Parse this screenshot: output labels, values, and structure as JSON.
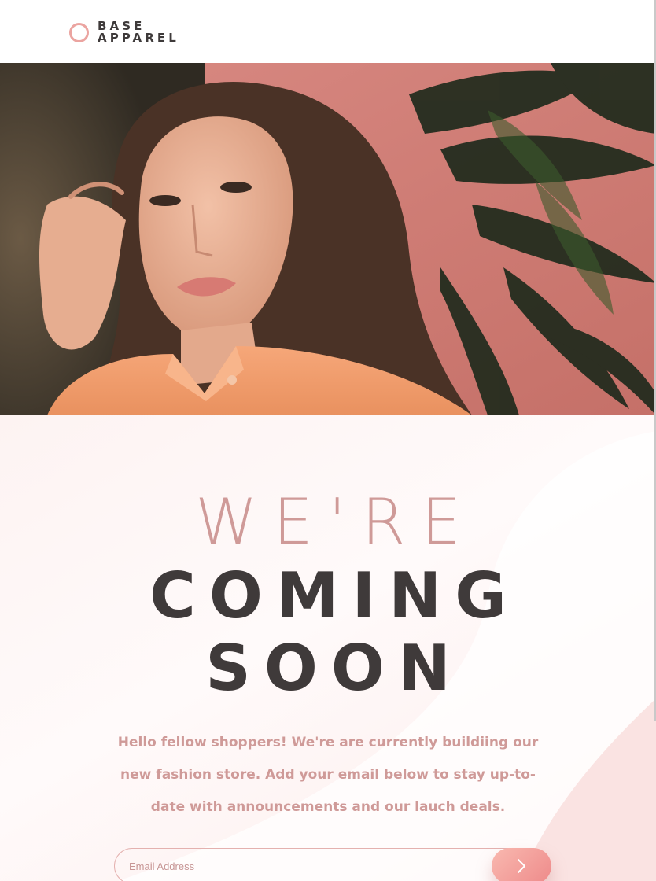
{
  "brand": {
    "logo_line1": "BASE",
    "logo_line2": "APPAREL",
    "accent_color": "#eba4a0",
    "text_color": "#3e3a3a"
  },
  "hero": {
    "image_alt": "Woman in an orange shirt in front of a pink wall with plants"
  },
  "main": {
    "headline_light": "WE'RE",
    "headline_dark_line1": "COMING",
    "headline_dark_line2": "SOON",
    "description": "Hello fellow shoppers! We're are currently buildiing our new fashion store. Add your email below to stay up-to-date with announcements and our lauch deals."
  },
  "subscribe": {
    "email_placeholder": "Email Address",
    "submit_icon": "chevron-right-icon",
    "button_colors": [
      "#f9b9b0",
      "#ee8a8a"
    ]
  }
}
